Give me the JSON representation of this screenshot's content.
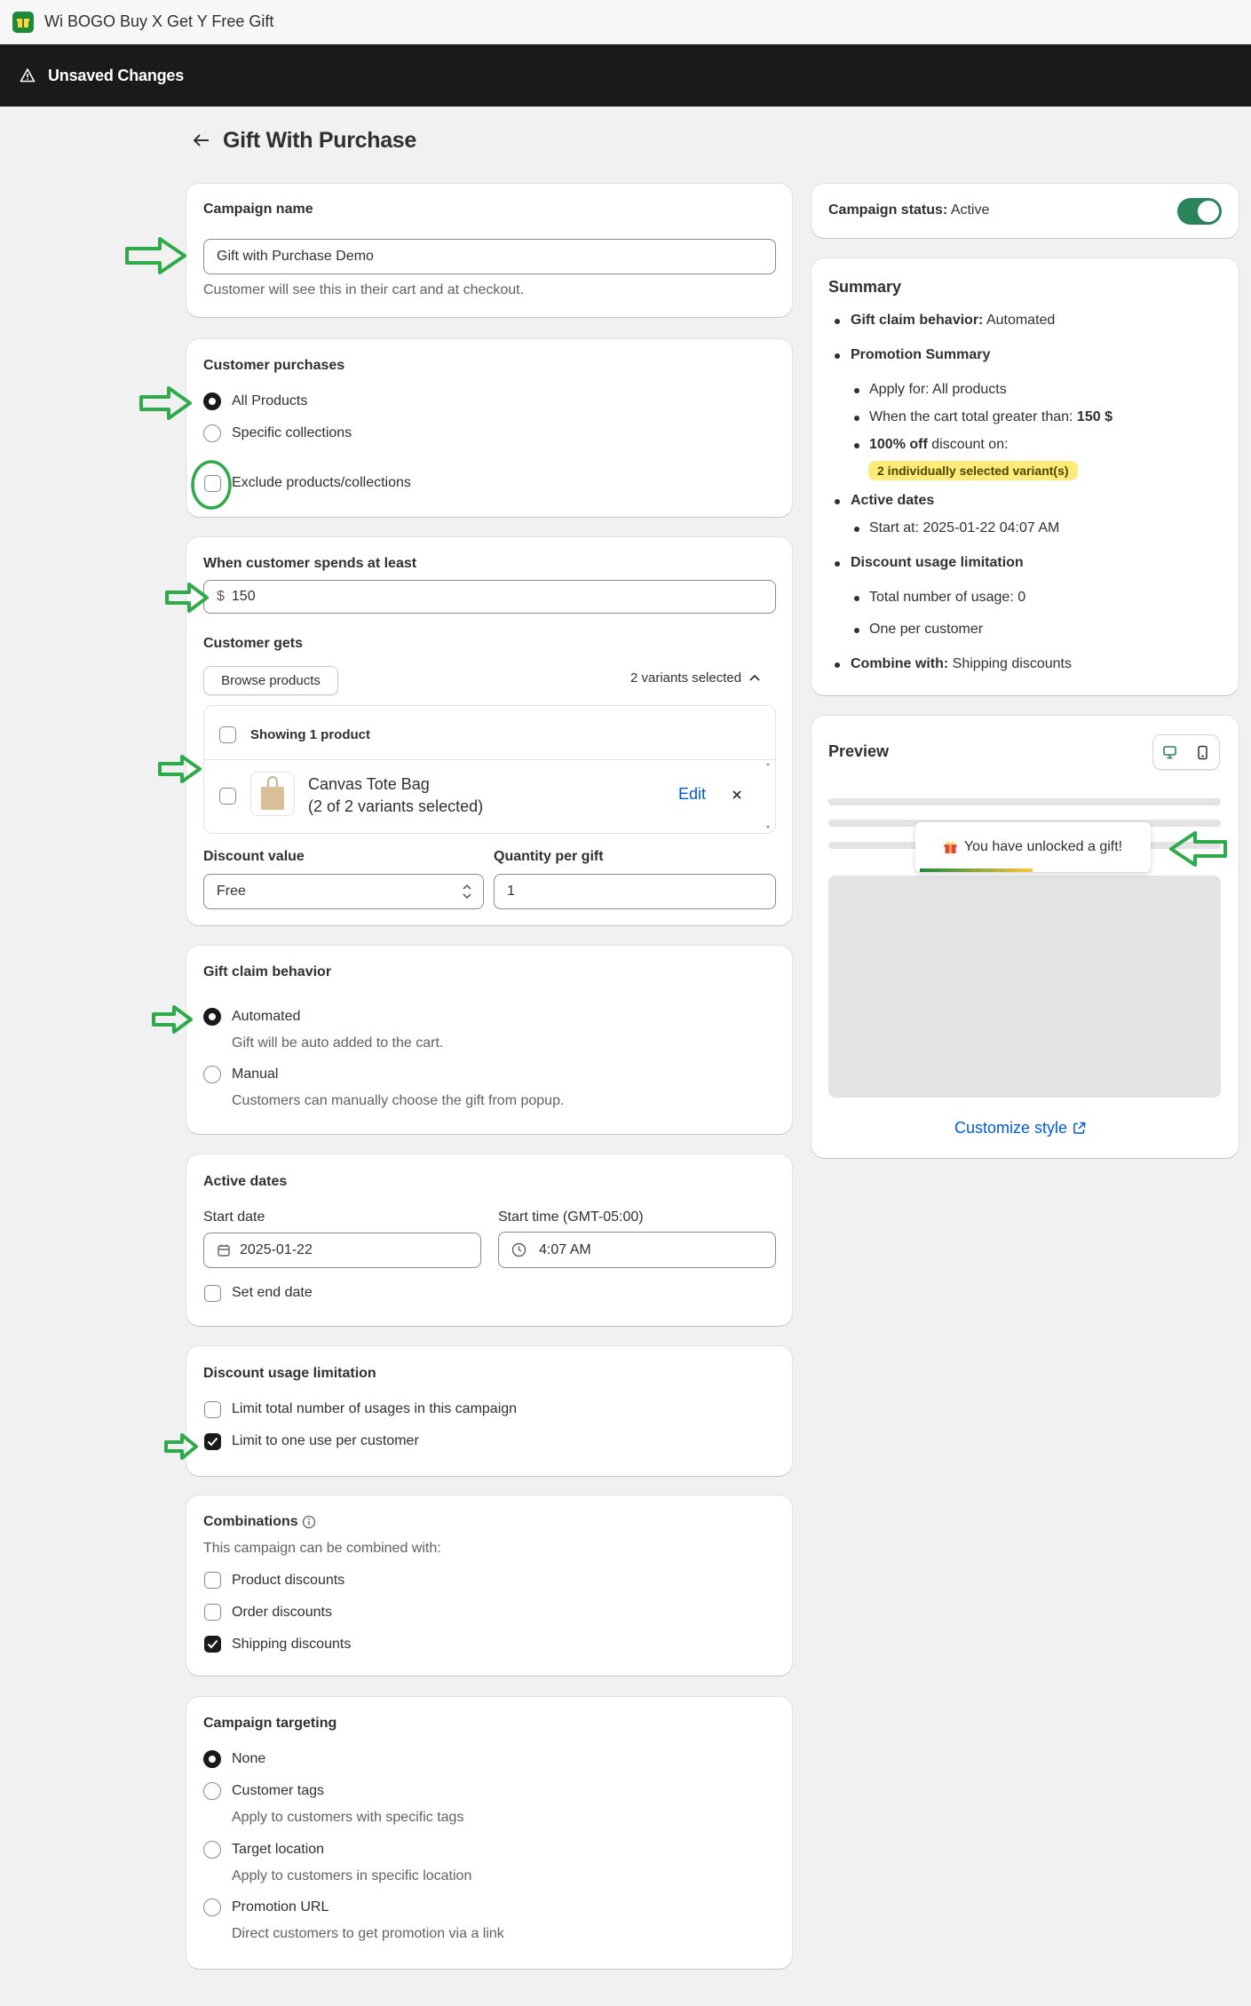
{
  "app": {
    "title": "Wi BOGO Buy X Get Y Free Gift"
  },
  "unsaved_bar": {
    "label": "Unsaved Changes"
  },
  "page": {
    "title": "Gift With Purchase"
  },
  "campaign_name": {
    "title": "Campaign name",
    "value": "Gift with Purchase Demo",
    "help": "Customer will see this in their cart and at checkout."
  },
  "customer_purchases": {
    "title": "Customer purchases",
    "options": [
      {
        "label": "All Products",
        "selected": true
      },
      {
        "label": "Specific collections",
        "selected": false
      }
    ],
    "exclude_label": "Exclude products/collections"
  },
  "spend": {
    "title": "When customer spends at least",
    "currency_prefix": "$",
    "value": "150",
    "gets_title": "Customer gets",
    "browse_label": "Browse products",
    "variants_selected": "2 variants selected",
    "showing_label": "Showing 1 product",
    "product_name": "Canvas Tote Bag",
    "product_variants": "(2 of 2 variants selected)",
    "edit_label": "Edit",
    "discount_value_label": "Discount value",
    "discount_value": "Free",
    "quantity_label": "Quantity per gift",
    "quantity_value": "1"
  },
  "gift_claim": {
    "title": "Gift claim behavior",
    "options": [
      {
        "label": "Automated",
        "help": "Gift will be auto added to the cart.",
        "selected": true
      },
      {
        "label": "Manual",
        "help": "Customers can manually choose the gift from popup.",
        "selected": false
      }
    ]
  },
  "active_dates": {
    "title": "Active dates",
    "start_date_label": "Start date",
    "start_date": "2025-01-22",
    "start_time_label": "Start time (GMT-05:00)",
    "start_time": "4:07 AM",
    "end_date_label": "Set end date"
  },
  "usage_limit": {
    "title": "Discount usage limitation",
    "options": [
      {
        "label": "Limit total number of usages in this campaign",
        "checked": false
      },
      {
        "label": "Limit to one use per customer",
        "checked": true
      }
    ]
  },
  "combinations": {
    "title": "Combinations",
    "help": "This campaign can be combined with:",
    "options": [
      {
        "label": "Product discounts",
        "checked": false
      },
      {
        "label": "Order discounts",
        "checked": false
      },
      {
        "label": "Shipping discounts",
        "checked": true
      }
    ]
  },
  "targeting": {
    "title": "Campaign targeting",
    "options": [
      {
        "label": "None",
        "help": "",
        "selected": true
      },
      {
        "label": "Customer tags",
        "help": "Apply to customers with specific tags",
        "selected": false
      },
      {
        "label": "Target location",
        "help": "Apply to customers in specific location",
        "selected": false
      },
      {
        "label": "Promotion URL",
        "help": "Direct customers to get promotion via a link",
        "selected": false
      }
    ]
  },
  "status": {
    "label": "Campaign status:",
    "value": "Active",
    "toggle_on": true
  },
  "summary": {
    "title": "Summary",
    "claim_key": "Gift claim behavior:",
    "claim_val": "Automated",
    "promo_title": "Promotion Summary",
    "apply_for": "Apply for: All products",
    "cart_total_key": "When the cart total greater than:",
    "cart_total_val": "150 $",
    "discount_bold": "100% off",
    "discount_rest": "discount on:",
    "variants_badge": "2 individually selected variant(s)",
    "active_dates_title": "Active dates",
    "start_at": "Start at: 2025-01-22 04:07 AM",
    "usage_title": "Discount usage limitation",
    "usage_total": "Total number of usage: 0",
    "usage_one": "One per customer",
    "combine_key": "Combine with:",
    "combine_val": "Shipping discounts"
  },
  "preview": {
    "title": "Preview",
    "toast": "You have unlocked a gift!",
    "customize_label": "Customize style"
  },
  "colors": {
    "accent_green": "#29845a",
    "annotation_green": "#2eaa4a",
    "badge_yellow": "#ffeb78",
    "link_blue": "#005bd3"
  }
}
